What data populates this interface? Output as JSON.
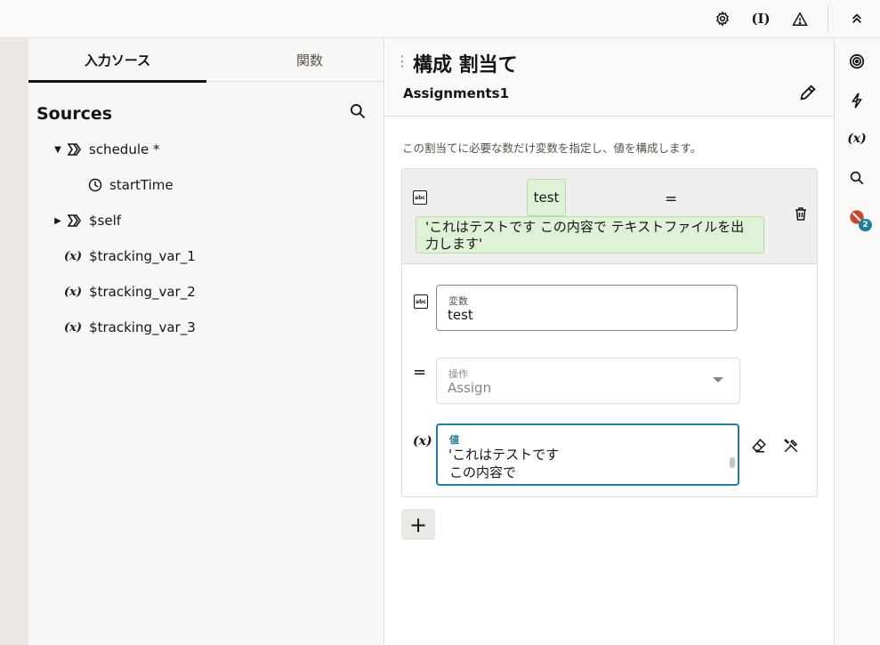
{
  "topbar": {
    "icons": [
      "gear-icon",
      "variable-inspect-icon",
      "warning-icon",
      "chevrons-up-icon"
    ],
    "var_icon_text": "(I)"
  },
  "sources_panel": {
    "tabs": [
      {
        "label": "入力ソース",
        "active": true
      },
      {
        "label": "関数",
        "active": false
      }
    ],
    "title": "Sources",
    "tree": [
      {
        "label": "schedule *",
        "expanded": true,
        "icon": "object-icon"
      },
      {
        "label": "startTime",
        "icon": "clock-icon"
      },
      {
        "label": "$self",
        "expanded": false,
        "icon": "object-icon"
      },
      {
        "label": "$tracking_var_1",
        "icon": "variable-icon"
      },
      {
        "label": "$tracking_var_2",
        "icon": "variable-icon"
      },
      {
        "label": "$tracking_var_3",
        "icon": "variable-icon"
      }
    ],
    "var_symbol": "(x)"
  },
  "main": {
    "title": "構成 割当て",
    "subtitle": "Assignments1",
    "description": "この割当てに必要な数だけ変数を指定し、値を構成します。",
    "assignment": {
      "head_variable": "test",
      "head_operator": "=",
      "head_value": "'これはテストです この内容で テキストファイルを出力します'",
      "variable_field": {
        "label": "変数",
        "value": "test"
      },
      "operator_field": {
        "label": "操作",
        "value": "Assign",
        "symbol": "="
      },
      "value_field": {
        "label": "値",
        "line1": "'これはテストです",
        "line2": "この内容で",
        "symbol": "(x)"
      }
    },
    "add_label": "+"
  },
  "right_rail": {
    "icons": [
      "target-icon",
      "lightning-icon",
      "variable-icon",
      "search-icon",
      "error-icon"
    ],
    "var_symbol": "(x)",
    "error_count": "2"
  },
  "colors": {
    "accent": "#227e9e",
    "pill_green": "#dff2d8",
    "error_red": "#c74634"
  }
}
